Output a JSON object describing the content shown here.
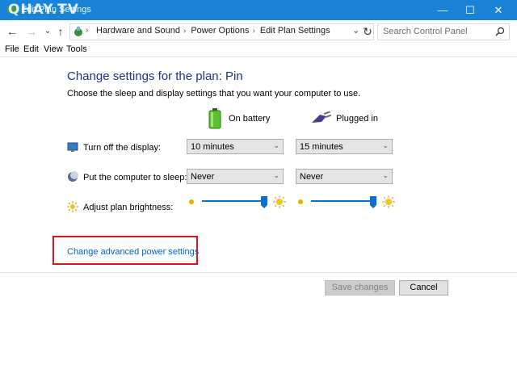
{
  "window": {
    "title": "Edit Plan Settings",
    "watermark": "QHAY.TV"
  },
  "window_controls": {
    "minimize": "—",
    "maximize": "☐",
    "close": "✕"
  },
  "nav": {
    "back": "←",
    "forward": "→",
    "history": "⌄",
    "up": "↑",
    "refresh": "↻"
  },
  "address": {
    "crumbs": [
      "Hardware and Sound",
      "Power Options",
      "Edit Plan Settings"
    ],
    "separator": "›",
    "root_separator": "›"
  },
  "search": {
    "placeholder": "Search Control Panel"
  },
  "menu": [
    "File",
    "Edit",
    "View",
    "Tools"
  ],
  "content": {
    "heading": "Change settings for the plan: Pin",
    "subtitle": "Choose the sleep and display settings that you want your computer to use.",
    "columns": {
      "battery": "On battery",
      "plugged": "Plugged in"
    },
    "rows": {
      "display": {
        "label": "Turn off the display:",
        "battery": "10 minutes",
        "plugged": "15 minutes"
      },
      "sleep": {
        "label": "Put the computer to sleep:",
        "battery": "Never",
        "plugged": "Never"
      },
      "brightness": {
        "label": "Adjust plan brightness:",
        "battery_level": 1.0,
        "plugged_level": 1.0
      }
    },
    "advanced_link": "Change advanced power settings"
  },
  "buttons": {
    "save": "Save changes",
    "cancel": "Cancel"
  },
  "colors": {
    "titlebar": "#1883d7",
    "heading": "#1e3287",
    "link": "#0066cc",
    "highlight": "#e0121b",
    "slider_thumb": "#0a6fd3"
  }
}
